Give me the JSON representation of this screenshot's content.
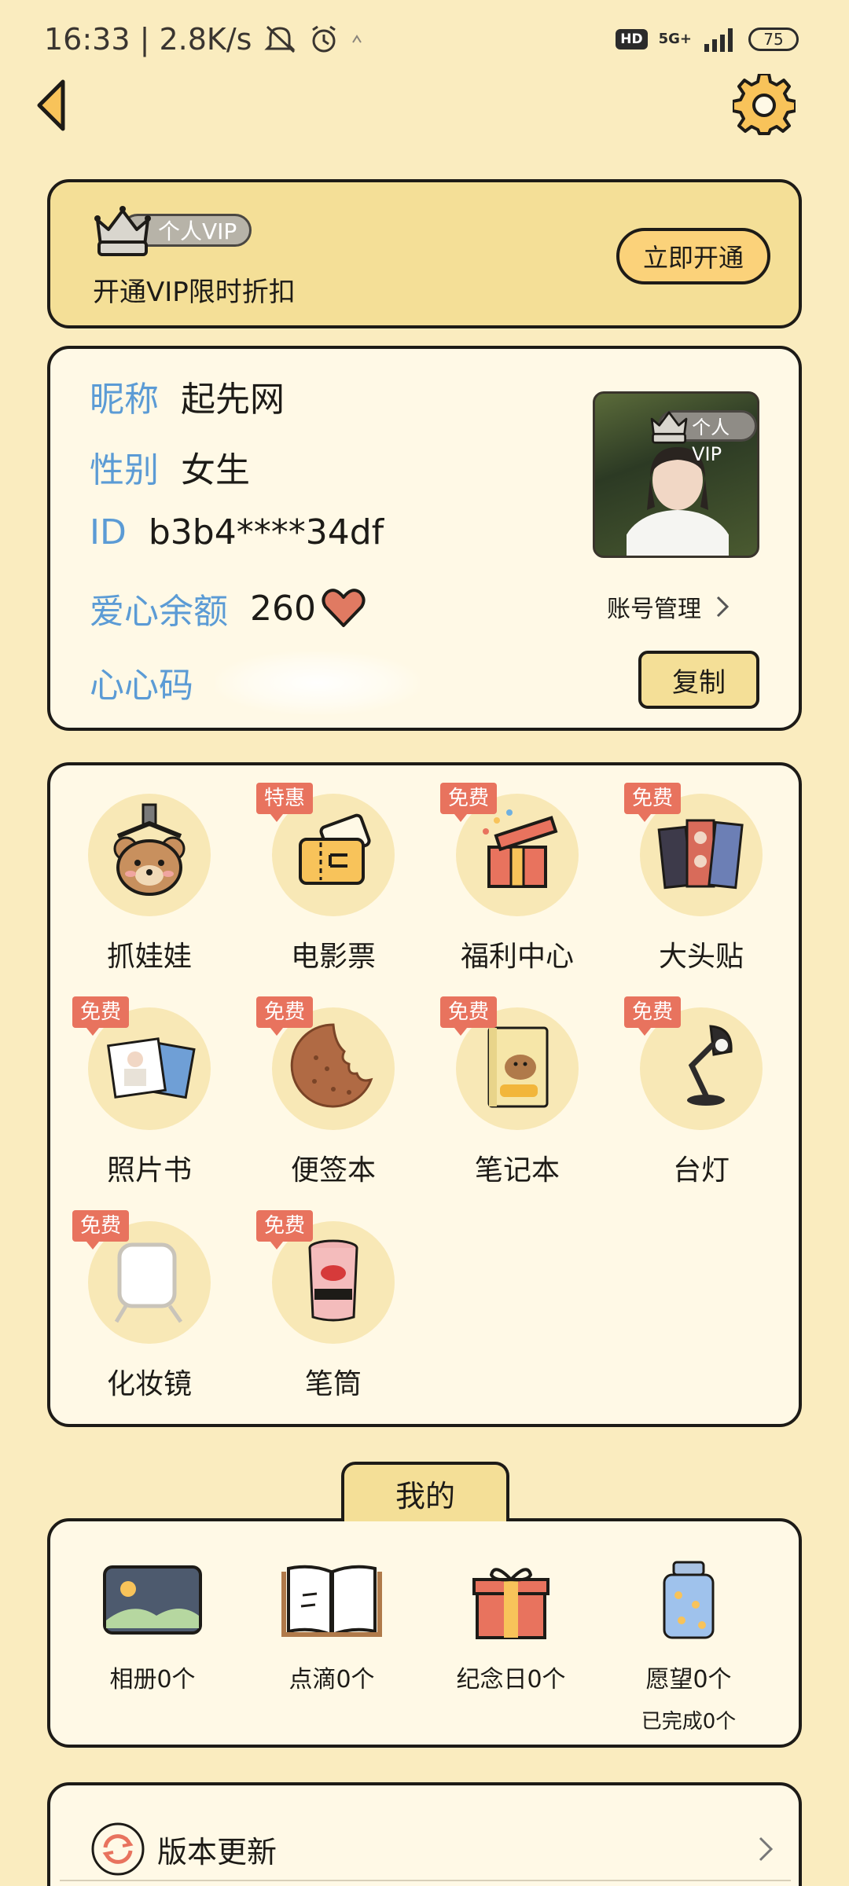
{
  "status_bar": {
    "time_speed": "16:33 | 2.8K/s",
    "hd": "HD",
    "network": "5G+",
    "battery": "75"
  },
  "vip_banner": {
    "badge": "个人VIP",
    "promo": "开通VIP限时折扣",
    "open_button": "立即开通"
  },
  "profile": {
    "nickname_label": "昵称",
    "nickname": "起先网",
    "gender_label": "性别",
    "gender": "女生",
    "id_label": "ID",
    "id_value": "b3b4****34df",
    "balance_label": "爱心余额",
    "balance": "260",
    "code_label": "心心码",
    "avatar_badge": "个人VIP",
    "account_manage": "账号管理",
    "copy_button": "复制"
  },
  "features": [
    {
      "label": "抓娃娃",
      "badge": "",
      "icon": "claw-bear-icon"
    },
    {
      "label": "电影票",
      "badge": "特惠",
      "icon": "ticket-icon"
    },
    {
      "label": "福利中心",
      "badge": "免费",
      "icon": "gift-box-icon"
    },
    {
      "label": "大头贴",
      "badge": "免费",
      "icon": "photo-sticker-icon"
    },
    {
      "label": "照片书",
      "badge": "免费",
      "icon": "photo-book-icon"
    },
    {
      "label": "便签本",
      "badge": "免费",
      "icon": "cookie-notepad-icon"
    },
    {
      "label": "笔记本",
      "badge": "免费",
      "icon": "notebook-icon"
    },
    {
      "label": "台灯",
      "badge": "免费",
      "icon": "desk-lamp-icon"
    },
    {
      "label": "化妆镜",
      "badge": "免费",
      "icon": "mirror-icon"
    },
    {
      "label": "笔筒",
      "badge": "免费",
      "icon": "pen-holder-icon"
    }
  ],
  "mine": {
    "tab": "我的",
    "items": [
      {
        "label": "相册0个",
        "sub": "",
        "icon": "album-icon"
      },
      {
        "label": "点滴0个",
        "sub": "",
        "icon": "open-book-icon"
      },
      {
        "label": "纪念日0个",
        "sub": "",
        "icon": "gift-icon"
      },
      {
        "label": "愿望0个",
        "sub": "已完成0个",
        "icon": "wish-jar-icon"
      }
    ]
  },
  "settings_list": {
    "update_label": "版本更新"
  },
  "colors": {
    "background": "#faecbf",
    "card": "#fff9e6",
    "vip_yellow": "#f4df97",
    "label_blue": "#5b9bd5",
    "badge_red": "#e8735e"
  }
}
